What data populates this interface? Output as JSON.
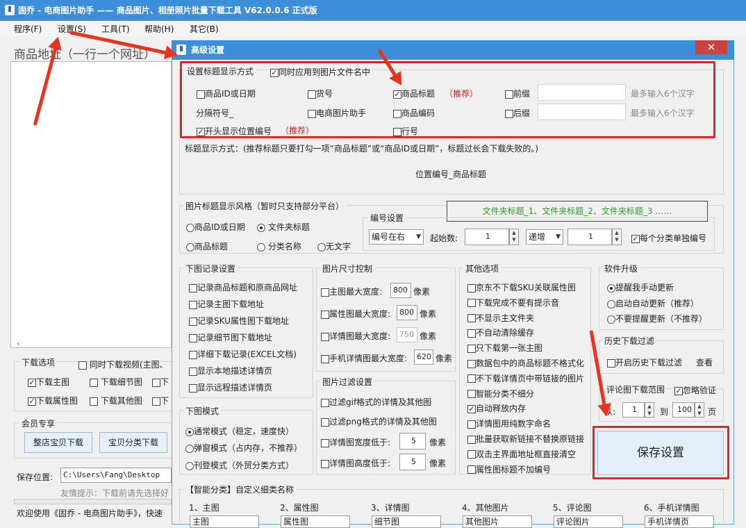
{
  "app": {
    "title": "固乔 - 电商图片助手 —— 商品图片、相册照片批量下载工具 V62.0.0.6 正式版"
  },
  "menu": [
    "程序(F)",
    "设置(S)",
    "工具(T)",
    "帮助(H)",
    "其它(B)"
  ],
  "main": {
    "url_label": "商品地址（一行一个网址）",
    "download_options": {
      "legend": "下载选项",
      "video": "同时下载视频(主图、",
      "items": [
        "下载主图",
        "下载细节图",
        "下载属性图",
        "下载其他图"
      ],
      "trunc": [
        "下",
        "下"
      ]
    },
    "member": {
      "legend": "会员专享",
      "btn_shop": "整店宝贝下载",
      "btn_category": "宝贝分类下载"
    },
    "save_location": {
      "label": "保存位置:",
      "path": "C:\\Users\\Fang\\Desktop"
    },
    "tip": "友情提示：下载前请先选择好",
    "welcome": "欢迎使用《固乔 - 电商图片助手》，快速"
  },
  "dialog": {
    "title": "高级设置",
    "close": "✕",
    "title_display": {
      "legend": "设置标题显示方式",
      "apply_filename": "同时应用到图片文件名中",
      "product_id_date": "商品ID或日期",
      "item_no": "货号",
      "product_title": "商品标题",
      "recommend": "（推荐）",
      "prefix": "前缀",
      "prefix_hint": "最多输入6个汉字",
      "separator": "分隔符号_",
      "app_name": "电商图片助手",
      "product_code": "商品编码",
      "suffix": "后缀",
      "suffix_hint": "最多输入6个汉字",
      "show_position": "开头显示位置编号",
      "recommend2": "（推荐）",
      "row_no": "行号"
    },
    "title_note": "标题显示方式：(推荐标题只要打勾一项“商品标题”或“商品ID或日期”，标题过长会下载失败的。)",
    "title_preview": "位置编号_商品标题",
    "style": {
      "legend": "图片标题显示风格（暂时只支持部分平台）",
      "product_id_date": "商品ID或日期",
      "folder_title": "文件夹标题",
      "product_title": "商品标题",
      "category_name": "分类名称",
      "no_text": "无文字",
      "folder_preview": "文件夹标题_1、文件夹标题_2、文件夹标题_3 ……"
    },
    "numbering": {
      "legend": "编号设置",
      "position": "编号在右",
      "start_label": "起始数:",
      "start_value": "1",
      "order": "递增",
      "step_value": "1",
      "per_category": "每个分类单独编号"
    },
    "record": {
      "legend": "下图记录设置",
      "items": [
        "记录商品标题和原商品网址",
        "记录主图下载地址",
        "记录SKU属性图下载地址",
        "记录细节图下载地址",
        "详细下载记录(EXCEL文档)",
        "显示本地描述详情页",
        "显示远程描述详情页"
      ]
    },
    "size": {
      "legend": "图片尺寸控制",
      "main_label": "主图最大宽度:",
      "main_value": "800",
      "attr_label": "属性图最大宽度:",
      "attr_value": "800",
      "detail_label": "详情图最大宽度:",
      "detail_value": "750",
      "mobile_label": "手机详情图最大宽度:",
      "mobile_value": "620",
      "unit": "像素"
    },
    "filter": {
      "legend": "图片过滤设置",
      "gif": "过滤gif格式的详情及其他图",
      "png": "过滤png格式的详情及其他图",
      "width_label": "详情图宽度低于:",
      "width_value": "5",
      "height_label": "详情图高度低于:",
      "height_value": "5",
      "unit": "像素"
    },
    "mode": {
      "legend": "下图模式",
      "normal": "通常模式（稳定，速度快）",
      "popup": "弹窗模式（占内存，不推荐）",
      "publish": "刊登模式（外贸分类方式）"
    },
    "other": {
      "legend": "其他选项",
      "items": [
        {
          "text": "京东不下载SKU关联属性图",
          "on": false
        },
        {
          "text": "下载完成不要有提示音",
          "on": false
        },
        {
          "text": "不显示主文件夹",
          "on": false
        },
        {
          "text": "不自动清除缓存",
          "on": false
        },
        {
          "text": "只下载第一张主图",
          "on": false
        },
        {
          "text": "数据包中的商品标题不格式化",
          "on": false
        },
        {
          "text": "不下载详情页中带链接的图片",
          "on": false
        },
        {
          "text": "智能分类不细分",
          "on": false
        },
        {
          "text": "自动释放内存",
          "on": true
        },
        {
          "text": "详情图用纯数字命名",
          "on": false
        },
        {
          "text": "批量获取新链接不替换原链接",
          "on": false
        },
        {
          "text": "双击主界面地址框直接清空",
          "on": false
        },
        {
          "text": "属性图标题不加编号",
          "on": false
        }
      ]
    },
    "upgrade": {
      "legend": "软件升级",
      "manual": "提醒我手动更新",
      "auto": "启动自动更新（推荐）",
      "none": "不要提醒更新（不推荐）"
    },
    "history": {
      "legend": "历史下载过滤",
      "enable": "开启历史下载过滤",
      "view": "查看"
    },
    "review": {
      "legend": "评论图下载范围",
      "ignore": "忽略验证",
      "from": "从:",
      "from_value": "1",
      "to": "到",
      "to_value": "100",
      "page": "页"
    },
    "save_button": "保存设置",
    "smart": {
      "legend": "【智能分类】自定义细类名称",
      "cols": [
        "1、主图",
        "2、属性图",
        "3、详情图",
        "4、其他图片",
        "5、评论图",
        "6、手机详情图"
      ],
      "values": [
        "主图",
        "属性图",
        "细节图",
        "其他图片",
        "评论图片",
        "手机详情页"
      ]
    }
  }
}
